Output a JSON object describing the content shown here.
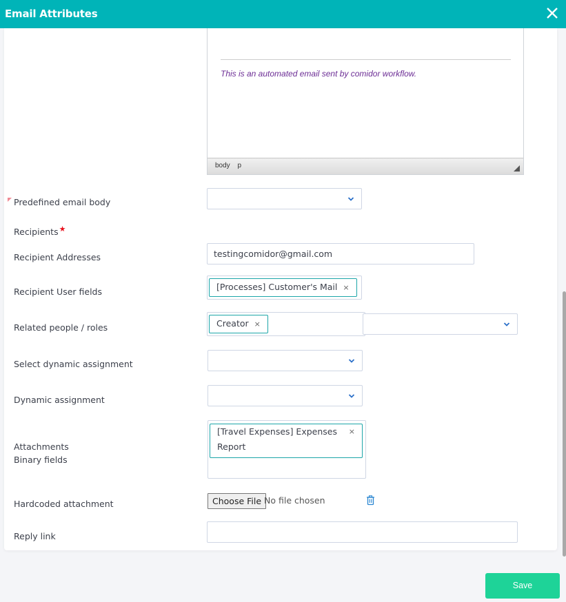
{
  "header": {
    "title": "Email Attributes",
    "close_icon": "close-icon"
  },
  "editor": {
    "signature": "This is an automated email sent by comidor workflow.",
    "status_path": [
      "body",
      "p"
    ]
  },
  "form": {
    "predefined_email_body": {
      "label": "Predefined email body",
      "value": ""
    },
    "recipients": {
      "label": "Recipients",
      "required_mark": "★"
    },
    "recipient_addresses": {
      "label": "Recipient Addresses",
      "value": "testingcomidor@gmail.com"
    },
    "recipient_user_fields": {
      "label": "Recipient User fields",
      "tags": [
        {
          "label": "[Processes] Customer's Mail",
          "remove": "×"
        }
      ]
    },
    "related_people_roles": {
      "label": "Related people / roles",
      "tags": [
        {
          "label": "Creator",
          "remove": "×"
        }
      ],
      "select_value": ""
    },
    "select_dynamic_assignment": {
      "label": "Select dynamic assignment",
      "value": ""
    },
    "dynamic_assignment": {
      "label": "Dynamic assignment",
      "value": ""
    },
    "attachments": {
      "label_line1": "Attachments",
      "label_line2": "Binary fields",
      "tags": [
        {
          "label_line1": "[Travel Expenses] Expenses",
          "label_line2": "Report",
          "remove": "×"
        }
      ]
    },
    "hardcoded_attachment": {
      "label": "Hardcoded attachment",
      "button_label": "Choose File",
      "file_status": "No file chosen"
    },
    "reply_link": {
      "label": "Reply link",
      "value": ""
    }
  },
  "footer": {
    "save_label": "Save"
  },
  "colors": {
    "header": "#00b4b8",
    "save": "#1ed398",
    "tag_border": "#1ba5a8",
    "required": "#e8101c",
    "signature": "#6c2d95"
  }
}
